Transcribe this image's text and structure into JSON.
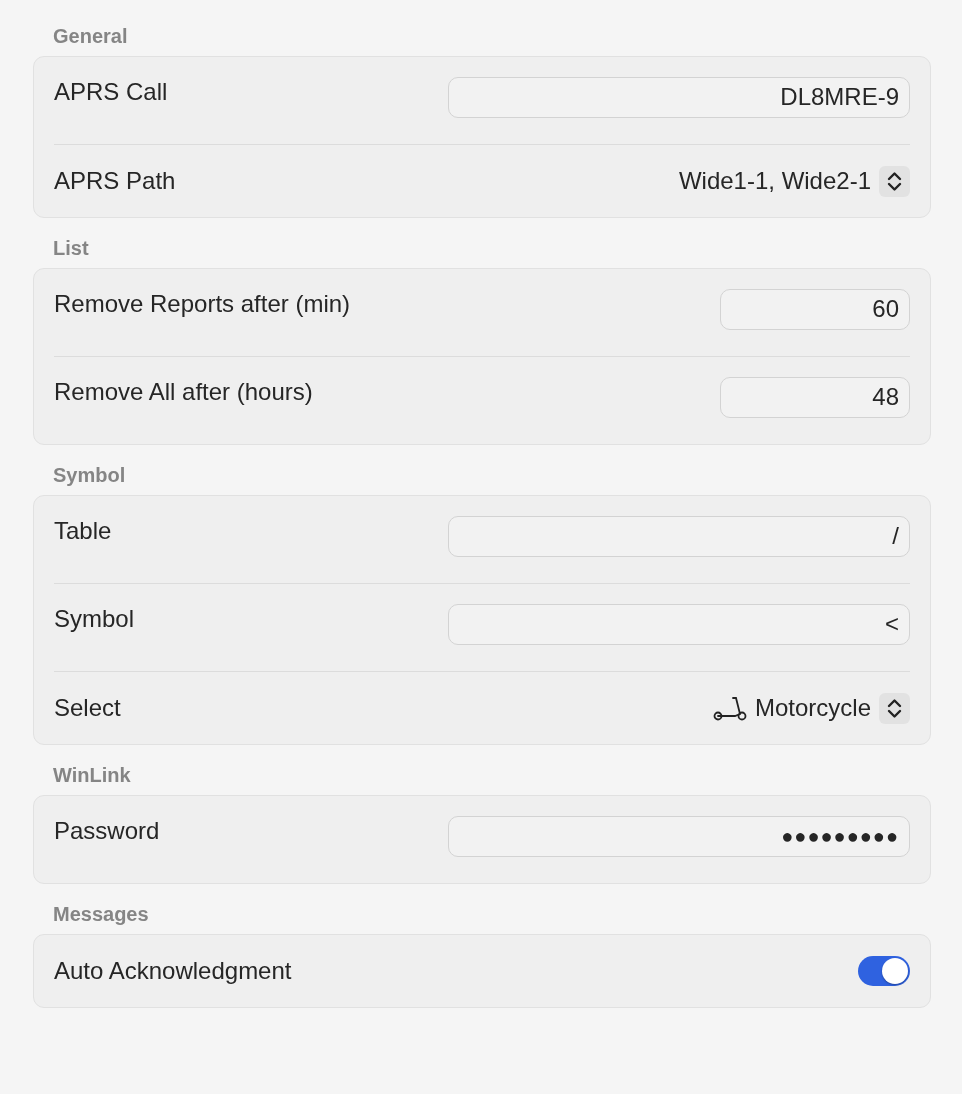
{
  "sections": [
    {
      "title": "General",
      "rows": [
        {
          "kind": "text",
          "label": "APRS Call",
          "value": "DL8MRE-9"
        },
        {
          "kind": "popup",
          "label": "APRS Path",
          "value": "Wide1-1, Wide2-1"
        }
      ]
    },
    {
      "title": "List",
      "rows": [
        {
          "kind": "number",
          "label": "Remove Reports after (min)",
          "value": "60"
        },
        {
          "kind": "number",
          "label": "Remove All after (hours)",
          "value": "48"
        }
      ]
    },
    {
      "title": "Symbol",
      "rows": [
        {
          "kind": "text",
          "label": "Table",
          "value": "/"
        },
        {
          "kind": "text",
          "label": "Symbol",
          "value": "<"
        },
        {
          "kind": "icon-popup",
          "label": "Select",
          "value": "Motorcycle"
        }
      ]
    },
    {
      "title": "WinLink",
      "rows": [
        {
          "kind": "secure",
          "label": "Password",
          "value": "●●●●●●●●●"
        }
      ]
    },
    {
      "title": "Messages",
      "rows": [
        {
          "kind": "toggle",
          "label": "Auto Acknowledgment",
          "on": true
        }
      ]
    }
  ]
}
